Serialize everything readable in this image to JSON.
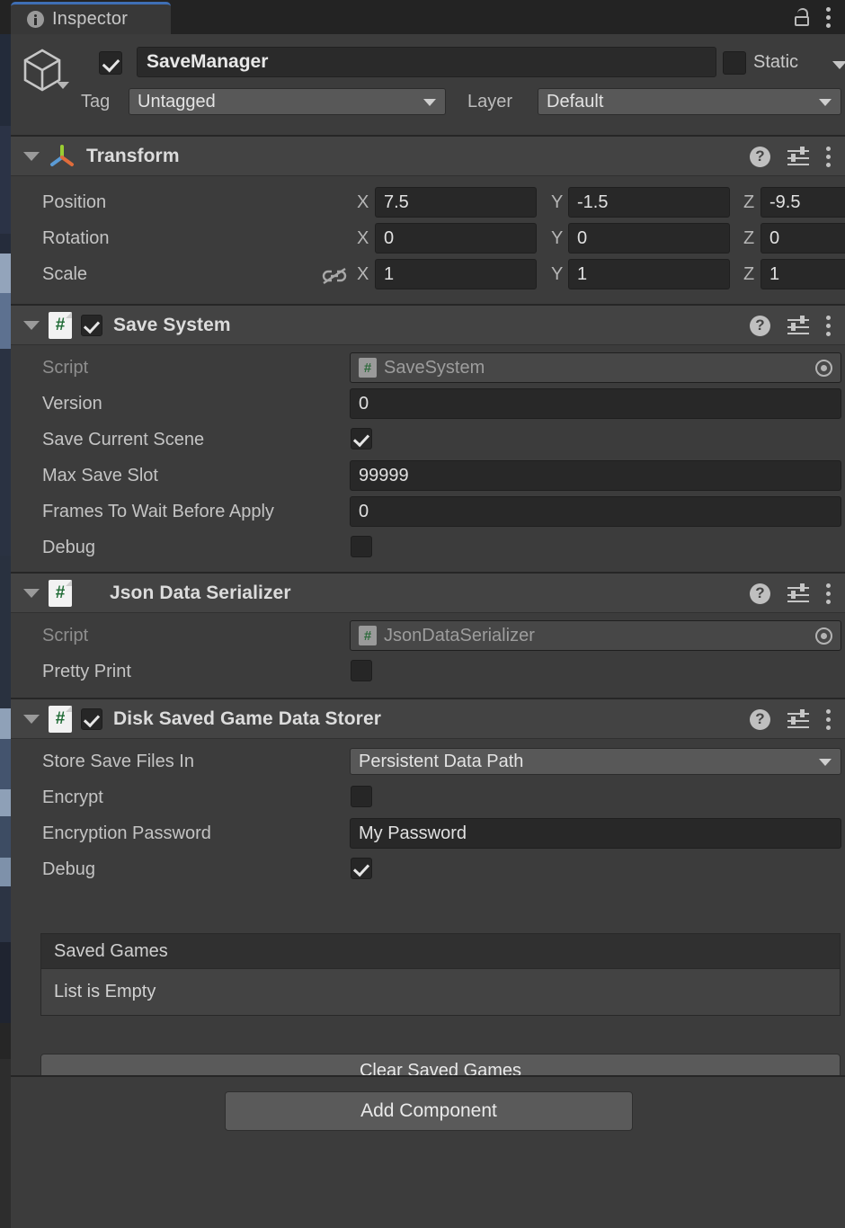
{
  "window": {
    "tab_label": "Inspector",
    "tab_icon": "info-icon",
    "lock_icon": "lock-open-icon",
    "menu_icon": "kebab-menu-icon"
  },
  "gameobject": {
    "icon": "cube-icon",
    "enabled": true,
    "name": "SaveManager",
    "static_label": "Static",
    "static_checked": false,
    "tag_label": "Tag",
    "tag_value": "Untagged",
    "layer_label": "Layer",
    "layer_value": "Default"
  },
  "components": [
    {
      "title": "Transform",
      "icon": "transform-axis-icon",
      "has_enable_checkbox": false,
      "expanded": true,
      "help_icon": "help-icon",
      "preset_icon": "preset-icon",
      "menu_icon": "kebab-menu-icon",
      "vector_rows": [
        {
          "label": "Position",
          "x": "7.5",
          "y": "-1.5",
          "z": "-9.5",
          "link_icon": false
        },
        {
          "label": "Rotation",
          "x": "0",
          "y": "0",
          "z": "0",
          "link_icon": false
        },
        {
          "label": "Scale",
          "x": "1",
          "y": "1",
          "z": "1",
          "link_icon": true
        }
      ],
      "axis_labels": {
        "x": "X",
        "y": "Y",
        "z": "Z"
      }
    },
    {
      "title": "Save System",
      "icon": "csharp-script-icon",
      "has_enable_checkbox": true,
      "enabled": true,
      "expanded": true,
      "rows": [
        {
          "label": "Script",
          "type": "object",
          "value": "SaveSystem",
          "dim": true,
          "icon": "csharp-script-icon",
          "picker_icon": "object-picker-icon"
        },
        {
          "label": "Version",
          "type": "text",
          "value": "0"
        },
        {
          "label": "Save Current Scene",
          "type": "checkbox",
          "checked": true
        },
        {
          "label": "Max Save Slot",
          "type": "text",
          "value": "99999"
        },
        {
          "label": "Frames To Wait Before Apply",
          "type": "text",
          "value": "0"
        },
        {
          "label": "Debug",
          "type": "checkbox",
          "checked": false
        }
      ]
    },
    {
      "title": "Json Data Serializer",
      "icon": "csharp-script-icon",
      "has_enable_checkbox": false,
      "expanded": true,
      "rows": [
        {
          "label": "Script",
          "type": "object",
          "value": "JsonDataSerializer",
          "dim": true,
          "icon": "csharp-script-icon",
          "picker_icon": "object-picker-icon"
        },
        {
          "label": "Pretty Print",
          "type": "checkbox",
          "checked": false
        }
      ]
    },
    {
      "title": "Disk Saved Game Data Storer",
      "icon": "csharp-script-icon",
      "has_enable_checkbox": true,
      "enabled": true,
      "expanded": true,
      "rows": [
        {
          "label": "Store Save Files In",
          "type": "dropdown",
          "value": "Persistent Data Path"
        },
        {
          "label": "Encrypt",
          "type": "checkbox",
          "checked": false
        },
        {
          "label": "Encryption Password",
          "type": "text",
          "value": "My Password"
        },
        {
          "label": "Debug",
          "type": "checkbox",
          "checked": true
        }
      ],
      "list": {
        "header": "Saved Games",
        "empty_text": "List is Empty"
      },
      "clear_button": "Clear Saved Games"
    }
  ],
  "add_component_button": "Add Component"
}
